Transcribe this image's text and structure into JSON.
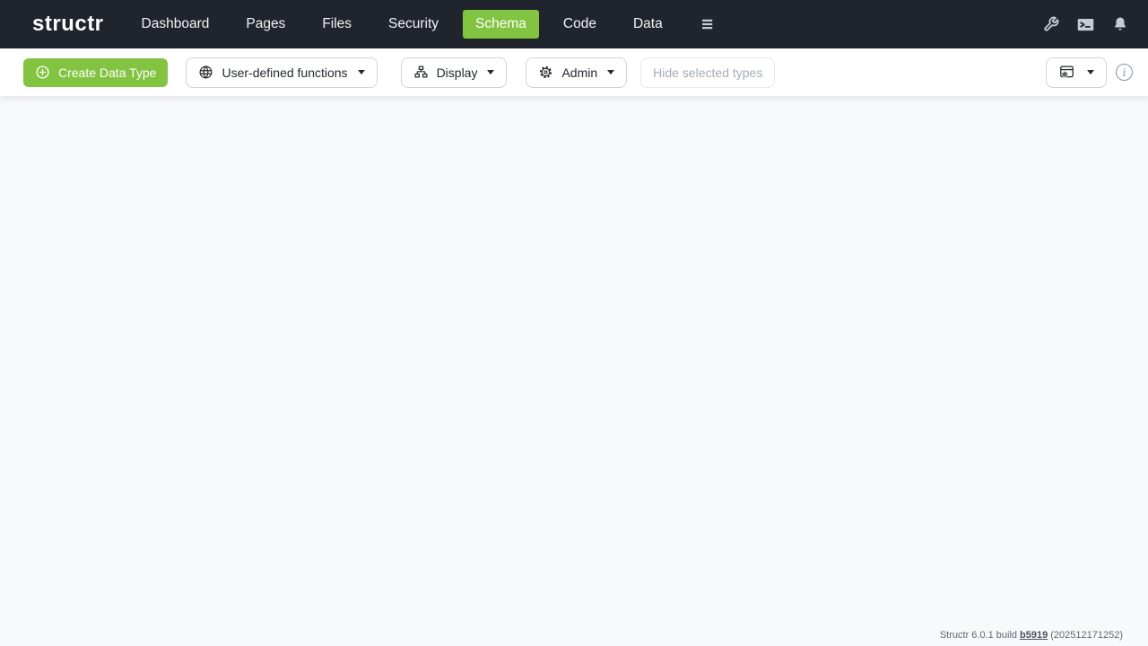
{
  "navbar": {
    "logo": "structr",
    "items": [
      {
        "label": "Dashboard",
        "active": false
      },
      {
        "label": "Pages",
        "active": false
      },
      {
        "label": "Files",
        "active": false
      },
      {
        "label": "Security",
        "active": false
      },
      {
        "label": "Schema",
        "active": true
      },
      {
        "label": "Code",
        "active": false
      },
      {
        "label": "Data",
        "active": false
      }
    ],
    "right_icons": [
      "wrench-icon",
      "terminal-icon",
      "bell-icon"
    ]
  },
  "toolbar": {
    "create_button": "Create Data Type",
    "udf_button": "User-defined functions",
    "display_button": "Display",
    "admin_button": "Admin",
    "hide_selected_button": "Hide selected types",
    "layout_button_icon": "layout-settings-icon",
    "info_icon": "i"
  },
  "footer": {
    "prefix": "Structr 6.0.1 build",
    "build_link": "b5919",
    "suffix": "(202512171252)"
  },
  "colors": {
    "accent_green": "#82c341",
    "navbar_bg": "#20242d",
    "canvas_bg": "#f8f9fb"
  }
}
